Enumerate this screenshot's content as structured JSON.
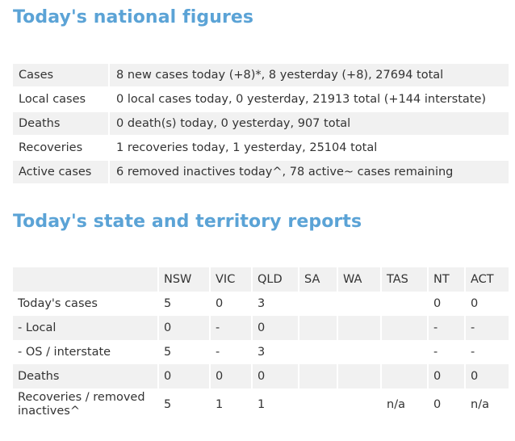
{
  "national": {
    "heading": "Today's national figures",
    "rows": [
      {
        "label": "Cases",
        "value": "8 new cases today (+8)*, 8 yesterday (+8), 27694 total"
      },
      {
        "label": "Local cases",
        "value": "0 local cases today, 0 yesterday, 21913 total (+144 interstate)"
      },
      {
        "label": "Deaths",
        "value": "0 death(s) today, 0 yesterday, 907 total"
      },
      {
        "label": "Recoveries",
        "value": "1 recoveries today, 1 yesterday, 25104 total"
      },
      {
        "label": "Active cases",
        "value": "6 removed inactives today^, 78 active~ cases remaining"
      }
    ]
  },
  "states": {
    "heading": "Today's state and territory reports",
    "columns": [
      "NSW",
      "VIC",
      "QLD",
      "SA",
      "WA",
      "TAS",
      "NT",
      "ACT"
    ],
    "rows": [
      {
        "label": "Today's cases",
        "cells": [
          "5",
          "0",
          "3",
          "",
          "",
          "",
          "0",
          "0"
        ]
      },
      {
        "label": "- Local",
        "cells": [
          "0",
          "-",
          "0",
          "",
          "",
          "",
          "-",
          "-"
        ]
      },
      {
        "label": "- OS / interstate",
        "cells": [
          "5",
          "-",
          "3",
          "",
          "",
          "",
          "-",
          "-"
        ]
      },
      {
        "label": "Deaths",
        "cells": [
          "0",
          "0",
          "0",
          "",
          "",
          "",
          "0",
          "0"
        ]
      },
      {
        "label": "Recoveries / removed inactives^",
        "cells": [
          "5",
          "1",
          "1",
          "",
          "",
          "n/a",
          "0",
          "n/a"
        ]
      }
    ]
  },
  "colors": {
    "heading": "#5ba3d6",
    "row_shade": "#f1f1f1",
    "text": "#333333"
  }
}
